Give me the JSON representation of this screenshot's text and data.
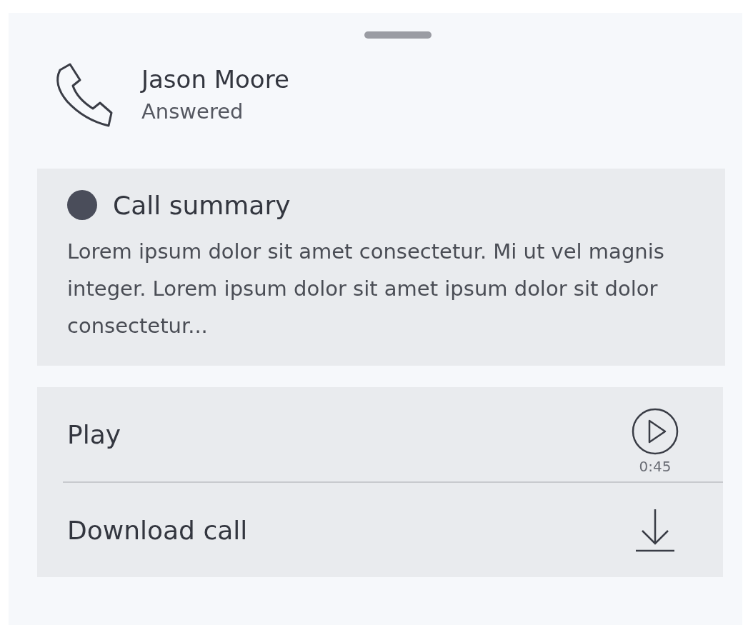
{
  "contact": {
    "name": "Jason Moore",
    "status": "Answered"
  },
  "summary": {
    "title": "Call summary",
    "color": "#4a4d5a",
    "text": "Lorem ipsum dolor sit amet consectetur. Mi ut vel magnis integer. Lorem ipsum dolor sit amet ipsum dolor sit dolor consectetur..."
  },
  "actions": [
    {
      "kind": "play",
      "label": "Play",
      "duration": "0:45"
    },
    {
      "kind": "download",
      "label": "Download call"
    }
  ]
}
